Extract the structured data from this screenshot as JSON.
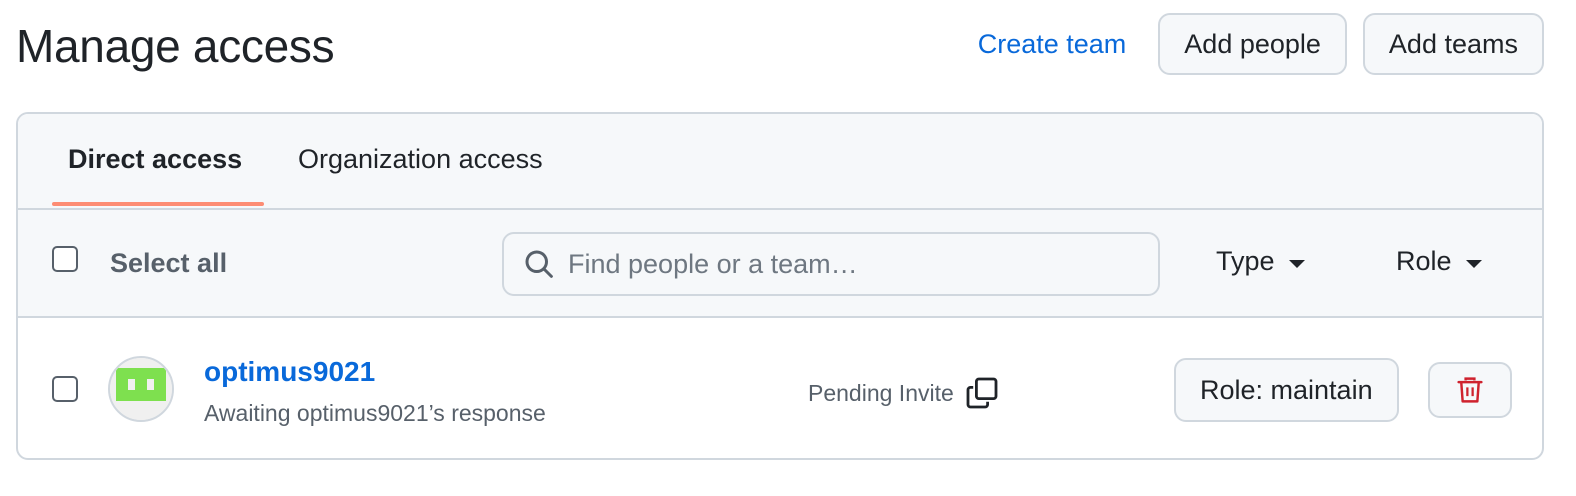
{
  "page": {
    "title": "Manage access"
  },
  "header": {
    "create_team": "Create team",
    "add_people": "Add people",
    "add_teams": "Add teams"
  },
  "tabs": [
    {
      "label": "Direct access",
      "active": true
    },
    {
      "label": "Organization access",
      "active": false
    }
  ],
  "toolbar": {
    "select_all": "Select all",
    "search_placeholder": "Find people or a team…",
    "type_filter": "Type",
    "role_filter": "Role"
  },
  "members": [
    {
      "username": "optimus9021",
      "subtitle": "Awaiting optimus9021’s response",
      "status": "Pending Invite",
      "role_button": "Role: maintain",
      "avatar_icon": "identicon-green"
    }
  ],
  "colors": {
    "link": "#0969da",
    "tab_underline": "#fd8c73",
    "danger": "#cf222e",
    "avatar_green": "#7ee04f"
  }
}
